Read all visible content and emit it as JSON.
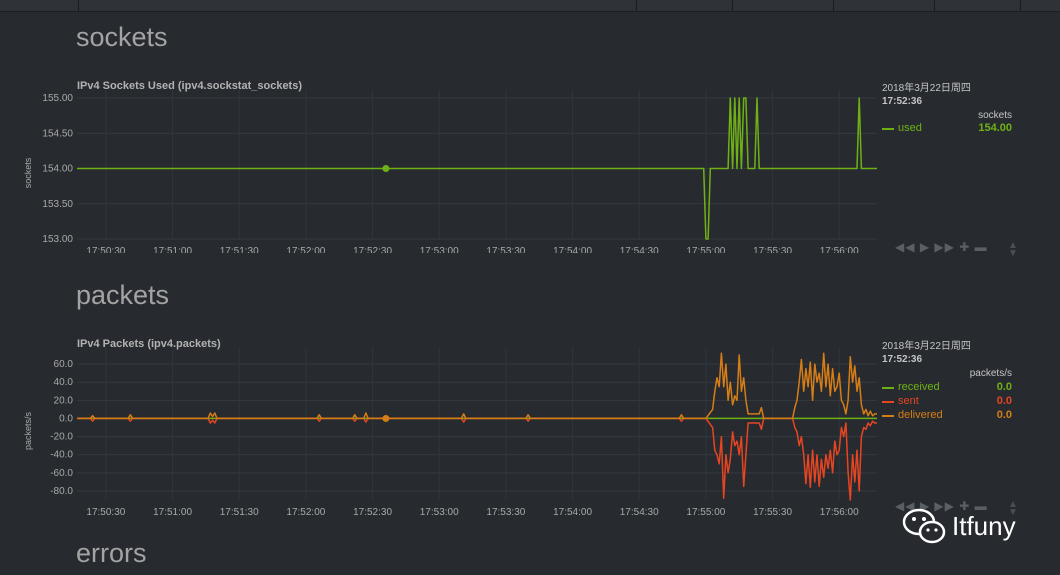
{
  "sections": [
    {
      "title": "sockets"
    },
    {
      "title": "packets"
    },
    {
      "title": "errors"
    }
  ],
  "colors": {
    "used": "#6fb114",
    "received": "#6fb114",
    "sent": "#e64522",
    "delivered": "#d67d16"
  },
  "controls_icons": [
    "rewind-icon",
    "play-icon",
    "forward-icon",
    "zoom-in-icon",
    "zoom-out-icon"
  ],
  "watermark": {
    "text": "Itfuny",
    "icon": "wechat-icon"
  },
  "chart_data": [
    {
      "type": "line",
      "title": "IPv4 Sockets Used (ipv4.sockstat_sockets)",
      "ylabel": "sockets",
      "units": "sockets",
      "ylim": [
        153.0,
        155.0
      ],
      "yticks": [
        "155.00",
        "154.50",
        "154.00",
        "153.50",
        "153.00"
      ],
      "yticks_values": [
        155.0,
        154.5,
        154.0,
        153.5,
        153.0
      ],
      "x_range": [
        "17:50:17",
        "17:56:17"
      ],
      "xticks": [
        "17:50:30",
        "17:51:00",
        "17:51:30",
        "17:52:00",
        "17:52:30",
        "17:53:00",
        "17:53:30",
        "17:54:00",
        "17:54:30",
        "17:55:00",
        "17:55:30",
        "17:56:00"
      ],
      "grid": true,
      "legend": {
        "date": "2018年3月22日周四",
        "time": "17:52:36",
        "entries": [
          {
            "name": "used",
            "value": "154.00"
          }
        ]
      },
      "highlight": {
        "x": "17:52:36",
        "y": 154.0
      },
      "series": [
        {
          "name": "used",
          "x": [
            "17:50:17",
            "17:54:59",
            "17:55:00",
            "17:55:01",
            "17:55:02",
            "17:55:10",
            "17:55:11",
            "17:55:12",
            "17:55:13",
            "17:55:14",
            "17:55:15",
            "17:55:16",
            "17:55:17",
            "17:55:18",
            "17:55:19",
            "17:55:22",
            "17:55:23",
            "17:55:24",
            "17:56:08",
            "17:56:09",
            "17:56:10",
            "17:56:17"
          ],
          "values": [
            154.0,
            154.0,
            153.0,
            153.0,
            154.0,
            154.0,
            155.0,
            154.0,
            155.0,
            154.0,
            155.0,
            154.0,
            155.0,
            155.0,
            154.0,
            154.0,
            155.0,
            154.0,
            154.0,
            155.0,
            154.0,
            154.0
          ]
        }
      ]
    },
    {
      "type": "line",
      "title": "IPv4 Packets (ipv4.packets)",
      "ylabel": "packets/s",
      "units": "packets/s",
      "ylim": [
        -90.0,
        70.0
      ],
      "yticks": [
        "60.0",
        "40.0",
        "20.0",
        "0.0",
        "-20.0",
        "-40.0",
        "-60.0",
        "-80.0"
      ],
      "yticks_values": [
        60,
        40,
        20,
        0,
        -20,
        -40,
        -60,
        -80
      ],
      "x_range": [
        "17:50:17",
        "17:56:17"
      ],
      "xticks": [
        "17:50:30",
        "17:51:00",
        "17:51:30",
        "17:52:00",
        "17:52:30",
        "17:53:00",
        "17:53:30",
        "17:54:00",
        "17:54:30",
        "17:55:00",
        "17:55:30",
        "17:56:00"
      ],
      "grid": true,
      "legend": {
        "date": "2018年3月22日周四",
        "time": "17:52:36",
        "entries": [
          {
            "name": "received",
            "value": "0.0"
          },
          {
            "name": "sent",
            "value": "0.0"
          },
          {
            "name": "delivered",
            "value": "0.0"
          }
        ]
      },
      "highlight": {
        "x": "17:52:36",
        "y": 0.0
      },
      "series": [
        {
          "name": "received",
          "x": [
            "17:50:17",
            "17:56:17"
          ],
          "values": [
            0,
            0
          ]
        },
        {
          "name": "sent",
          "x": [
            "17:50:17",
            "17:50:23",
            "17:50:24",
            "17:50:25",
            "17:50:40",
            "17:50:41",
            "17:50:42",
            "17:51:16",
            "17:51:17",
            "17:51:18",
            "17:51:19",
            "17:51:20",
            "17:52:05",
            "17:52:06",
            "17:52:07",
            "17:52:21",
            "17:52:22",
            "17:52:23",
            "17:52:26",
            "17:52:27",
            "17:52:28",
            "17:53:10",
            "17:53:11",
            "17:53:12",
            "17:53:39",
            "17:53:40",
            "17:53:41",
            "17:54:48",
            "17:54:49",
            "17:54:50",
            "17:55:00",
            "17:55:03",
            "17:55:04",
            "17:55:05",
            "17:55:06",
            "17:55:07",
            "17:55:08",
            "17:55:09",
            "17:55:10",
            "17:55:11",
            "17:55:12",
            "17:55:13",
            "17:55:14",
            "17:55:15",
            "17:55:16",
            "17:55:17",
            "17:55:18",
            "17:55:19",
            "17:55:24",
            "17:55:25",
            "17:55:26",
            "17:55:39",
            "17:55:40",
            "17:55:41",
            "17:55:42",
            "17:55:43",
            "17:55:44",
            "17:55:45",
            "17:55:46",
            "17:55:47",
            "17:55:48",
            "17:55:49",
            "17:55:50",
            "17:55:51",
            "17:55:52",
            "17:55:53",
            "17:55:54",
            "17:55:55",
            "17:55:56",
            "17:55:57",
            "17:55:58",
            "17:55:59",
            "17:56:00",
            "17:56:01",
            "17:56:02",
            "17:56:03",
            "17:56:04",
            "17:56:05",
            "17:56:06",
            "17:56:07",
            "17:56:08",
            "17:56:09",
            "17:56:10",
            "17:56:11",
            "17:56:12",
            "17:56:13",
            "17:56:14",
            "17:56:15",
            "17:56:16",
            "17:56:17"
          ],
          "values": [
            0,
            0,
            -3,
            0,
            0,
            -3,
            0,
            0,
            -5,
            -2,
            -5,
            0,
            0,
            -3,
            0,
            0,
            -3,
            0,
            0,
            -4,
            0,
            0,
            -4,
            0,
            0,
            -3,
            0,
            0,
            -3,
            0,
            0,
            -10,
            -35,
            -40,
            -50,
            -20,
            -88,
            -40,
            -60,
            -45,
            -15,
            -30,
            -25,
            -40,
            -20,
            -75,
            -40,
            -5,
            -5,
            -12,
            0,
            0,
            -10,
            -15,
            -30,
            -20,
            -40,
            -72,
            -40,
            -76,
            -35,
            -70,
            -40,
            -75,
            -45,
            -65,
            -40,
            -55,
            -35,
            -60,
            -25,
            -40,
            -35,
            -10,
            -20,
            -5,
            -60,
            -90,
            -40,
            -70,
            -35,
            -80,
            -20,
            -10,
            -12,
            -5,
            -8,
            -3,
            -5,
            -5
          ]
        },
        {
          "name": "delivered",
          "x": [
            "17:50:17",
            "17:50:23",
            "17:50:24",
            "17:50:25",
            "17:50:40",
            "17:50:41",
            "17:50:42",
            "17:51:16",
            "17:51:17",
            "17:51:18",
            "17:51:19",
            "17:51:20",
            "17:52:05",
            "17:52:06",
            "17:52:07",
            "17:52:21",
            "17:52:22",
            "17:52:23",
            "17:52:26",
            "17:52:27",
            "17:52:28",
            "17:53:10",
            "17:53:11",
            "17:53:12",
            "17:53:39",
            "17:53:40",
            "17:53:41",
            "17:54:48",
            "17:54:49",
            "17:54:50",
            "17:55:00",
            "17:55:03",
            "17:55:04",
            "17:55:05",
            "17:55:06",
            "17:55:07",
            "17:55:08",
            "17:55:09",
            "17:55:10",
            "17:55:11",
            "17:55:12",
            "17:55:13",
            "17:55:14",
            "17:55:15",
            "17:55:16",
            "17:55:17",
            "17:55:18",
            "17:55:19",
            "17:55:24",
            "17:55:25",
            "17:55:26",
            "17:55:39",
            "17:55:40",
            "17:55:41",
            "17:55:42",
            "17:55:43",
            "17:55:44",
            "17:55:45",
            "17:55:46",
            "17:55:47",
            "17:55:48",
            "17:55:49",
            "17:55:50",
            "17:55:51",
            "17:55:52",
            "17:55:53",
            "17:55:54",
            "17:55:55",
            "17:55:56",
            "17:55:57",
            "17:55:58",
            "17:55:59",
            "17:56:00",
            "17:56:01",
            "17:56:02",
            "17:56:03",
            "17:56:04",
            "17:56:05",
            "17:56:06",
            "17:56:07",
            "17:56:08",
            "17:56:09",
            "17:56:10",
            "17:56:11",
            "17:56:12",
            "17:56:13",
            "17:56:14",
            "17:56:15",
            "17:56:16",
            "17:56:17"
          ],
          "values": [
            0,
            0,
            3,
            0,
            0,
            4,
            0,
            0,
            6,
            2,
            6,
            0,
            0,
            4,
            0,
            0,
            4,
            0,
            0,
            6,
            0,
            0,
            5,
            0,
            0,
            4,
            0,
            0,
            4,
            0,
            0,
            10,
            30,
            45,
            35,
            72,
            35,
            60,
            20,
            40,
            15,
            25,
            20,
            70,
            30,
            45,
            20,
            5,
            5,
            12,
            0,
            0,
            12,
            20,
            40,
            65,
            30,
            55,
            35,
            62,
            20,
            60,
            40,
            50,
            30,
            72,
            35,
            60,
            25,
            55,
            30,
            35,
            50,
            20,
            15,
            5,
            20,
            68,
            40,
            58,
            30,
            45,
            15,
            5,
            10,
            3,
            8,
            3,
            5,
            5
          ]
        }
      ]
    }
  ]
}
